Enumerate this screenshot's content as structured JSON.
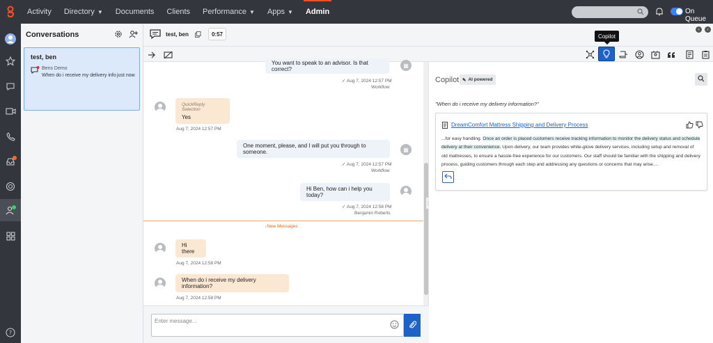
{
  "nav": {
    "items": [
      {
        "label": "Activity",
        "has_caret": false
      },
      {
        "label": "Directory",
        "has_caret": true
      },
      {
        "label": "Documents",
        "has_caret": false
      },
      {
        "label": "Clients",
        "has_caret": false
      },
      {
        "label": "Performance",
        "has_caret": true
      },
      {
        "label": "Apps",
        "has_caret": true
      },
      {
        "label": "Admin",
        "has_caret": false,
        "active": true
      }
    ],
    "status_label": "On Queue"
  },
  "conversations": {
    "title": "Conversations",
    "card": {
      "name": "test, ben",
      "source": "Bens Demo",
      "preview": "When do i receive my delivery info",
      "time": "just now"
    }
  },
  "interaction": {
    "title": "test, ben",
    "timer": "0:57"
  },
  "toolbar": {
    "tooltip": "Copilot"
  },
  "transcript": {
    "messages": [
      {
        "text": "You want to speak to an advisor. Is that correct?",
        "meta1": "Aug 7, 2024 12:57 PM",
        "meta2": "Workflow"
      },
      {
        "label": "QuickReply Selection",
        "text": "Yes",
        "meta1": "Aug 7, 2024 12:57 PM"
      },
      {
        "text": "One moment, please, and I will put you through to someone.",
        "meta1": "Aug 7, 2024 12:57 PM",
        "meta2": "Workflow"
      },
      {
        "text": "Hi Ben, how can i help you today?",
        "meta1": "Aug 7, 2024 12:58 PM",
        "meta2": "Benjamin Roberts"
      },
      {
        "text": "Hi there",
        "meta1": "Aug 7, 2024 12:58 PM"
      },
      {
        "text": "When do i receive my delivery information?",
        "meta1": "Aug 7, 2024 12:58 PM"
      }
    ],
    "new_messages_label": "New Messages",
    "composer_placeholder": "Enter message..."
  },
  "copilot": {
    "title": "Copilot",
    "badge": "AI powered",
    "query": "\"When do i receive my delivery information?\"",
    "article": {
      "title": "DreamComfort Mattress Shipping and Delivery Process",
      "snippet_pre": "...for easy handling. ",
      "snippet_highlight": "Once an order is placed customers receive tracking information to monitor the delivery status and schedule delivery at their convenience.",
      "snippet_post": " Upon delivery, our team provides white-glove delivery services, including setup and removal of old mattresses, to ensure a hassle-free experience for our customers. Our staff should be familiar with the shipping and delivery process, guiding customers through each step and addressing any questions or concerns that may arise...."
    }
  }
}
